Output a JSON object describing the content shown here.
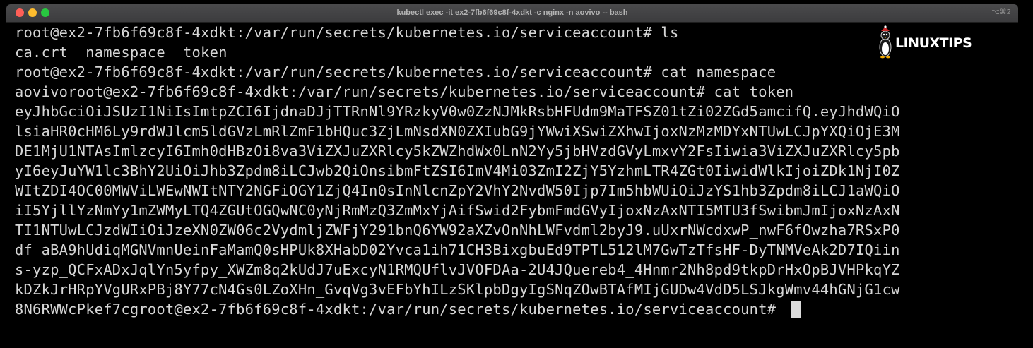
{
  "window": {
    "title": "kubectl exec -it ex2-7fb6f69c8f-4xdkt -c nginx -n aovivo -- bash",
    "shortcut": "⌥⌘2"
  },
  "logo": {
    "text": "LINUXTIPS",
    "icon": "penguin-icon"
  },
  "terminal": {
    "lines": [
      "root@ex2-7fb6f69c8f-4xdkt:/var/run/secrets/kubernetes.io/serviceaccount# ls",
      "ca.crt  namespace  token",
      "root@ex2-7fb6f69c8f-4xdkt:/var/run/secrets/kubernetes.io/serviceaccount# cat namespace",
      "aovivoroot@ex2-7fb6f69c8f-4xdkt:/var/run/secrets/kubernetes.io/serviceaccount# cat token",
      "eyJhbGciOiJSUzI1NiIsImtpZCI6IjdnaDJjTTRnNl9YRzkyV0w0ZzNJMkRsbHFUdm9MaTFSZ01tZi02ZGd5amcifQ.eyJhdWQiO",
      "lsiaHR0cHM6Ly9rdWJlcm5ldGVzLmRlZmF1bHQuc3ZjLmNsdXN0ZXIubG9jYWwiXSwiZXhwIjoxNzMzMDYxNTUwLCJpYXQiOjE3M",
      "DE1MjU1NTAsImlzcyI6Imh0dHBzOi8va3ViZXJuZXRlcy5kZWZhdWx0LnN2Yy5jbHVzdGVyLmxvY2FsIiwia3ViZXJuZXRlcy5pb",
      "yI6eyJuYW1lc3BhY2UiOiJhb3Zpdm8iLCJwb2QiOnsibmFtZSI6ImV4Mi03ZmI2ZjY5YzhmLTR4ZGt0IiwidWlkIjoiZDk1NjI0Z",
      "WItZDI4OC00MWViLWEwNWItNTY2NGFiOGY1ZjQ4In0sInNlcnZpY2VhY2NvdW50Ijp7Im5hbWUiOiJzYS1hb3Zpdm8iLCJ1aWQiO",
      "iI5YjllYzNmYy1mZWMyLTQ4ZGUtOGQwNC0yNjRmMzQ3ZmMxYjAifSwid2FybmFmdGVyIjoxNzAxNTI5MTU3fSwibmJmIjoxNzAxN",
      "TI1NTUwLCJzdWIiOiJzeXN0ZW06c2VydmljZWFjY291bnQ6YW92aXZvOnNhLWFvdml2byJ9.uUxrNWcdxwP_nwF6fOwzha7RSxP0",
      "df_aBA9hUdiqMGNVmnUeinFaMamQ0sHPUk8XHabD02Yvca1ih71CH3BixgbuEd9TPTL512lM7GwTzTfsHF-DyTNMVeAk2D7IQiin",
      "s-yzp_QCFxADxJqlYn5yfpy_XWZm8q2kUdJ7uExcyN1RMQUflvJVOFDAa-2U4JQuereb4_4Hnmr2Nh8pd9tkpDrHxOpBJVHPkqYZ",
      "kDZkJrHRpYVgURxPBj8Y77cN4Gs0LZoXHn_GvqVg3vEFbYhILzSKlpbDgyIgSNqZOwBTAfMIjGUDw4VdD5LSJkgWmv44hGNjG1cw",
      "8N6RWWcPkef7cgroot@ex2-7fb6f69c8f-4xdkt:/var/run/secrets/kubernetes.io/serviceaccount# "
    ]
  }
}
